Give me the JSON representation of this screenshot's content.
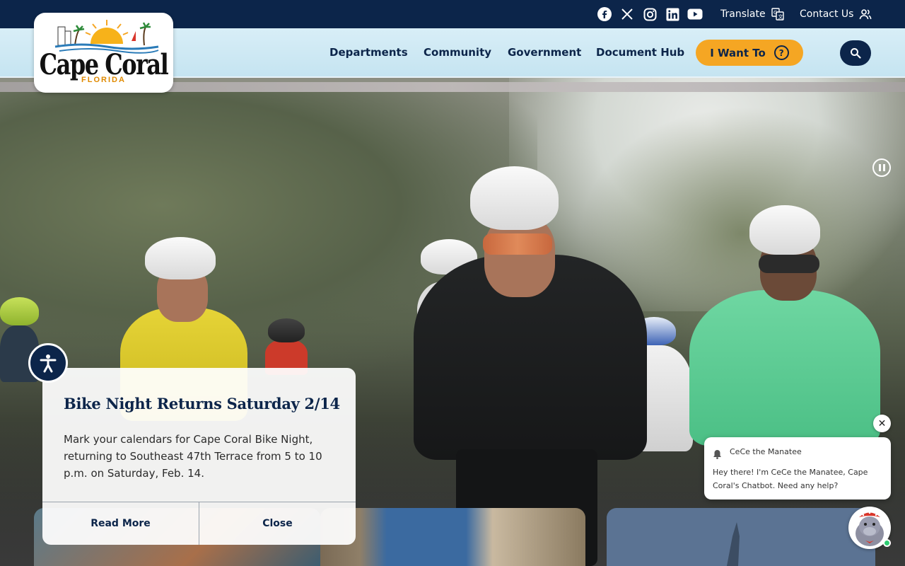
{
  "utility": {
    "social": [
      {
        "name": "facebook-icon"
      },
      {
        "name": "x-icon"
      },
      {
        "name": "instagram-icon"
      },
      {
        "name": "linkedin-icon"
      },
      {
        "name": "youtube-icon"
      }
    ],
    "translate_label": "Translate",
    "contact_label": "Contact Us"
  },
  "logo": {
    "city": "Cape Coral",
    "state": "FLORIDA"
  },
  "nav": {
    "items": [
      "Departments",
      "Community",
      "Government",
      "Document Hub"
    ],
    "cta_label": "I Want To",
    "cta_color": "#f5a623",
    "brand_color": "#0c254a"
  },
  "hero": {
    "slide_control": "pause-icon"
  },
  "news": {
    "title": "Bike Night Returns Saturday 2/14",
    "body": "Mark your calendars for Cape Coral Bike Night, returning to Southeast 47th Terrace from 5 to 10 p.m. on Saturday, Feb. 14.",
    "read_more": "Read More",
    "close": "Close"
  },
  "chatbot": {
    "name": "CeCe the Manatee",
    "message": "Hey there! I'm CeCe the Manatee, Cape Coral's Chatbot. Need any help?",
    "close_glyph": "✕",
    "status_color": "#2ecc71"
  }
}
